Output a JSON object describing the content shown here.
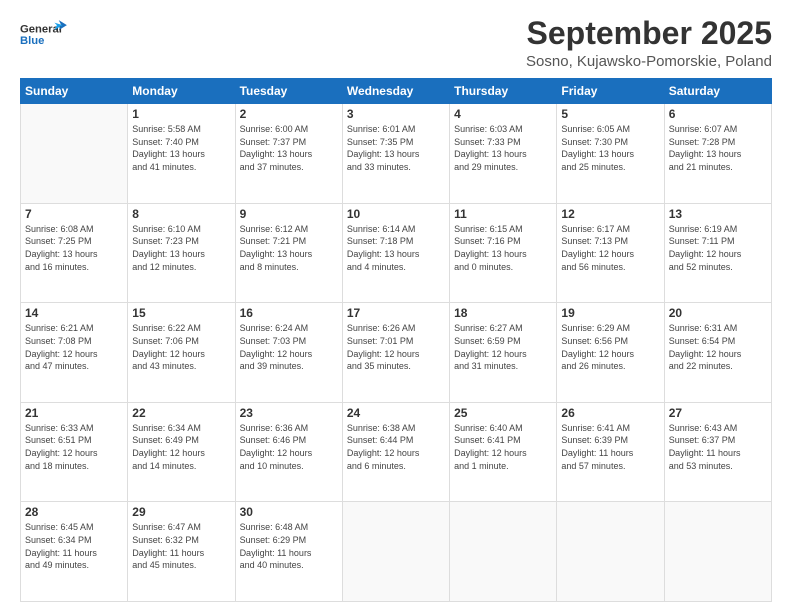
{
  "header": {
    "logo_general": "General",
    "logo_blue": "Blue",
    "title": "September 2025",
    "location": "Sosno, Kujawsko-Pomorskie, Poland"
  },
  "weekdays": [
    "Sunday",
    "Monday",
    "Tuesday",
    "Wednesday",
    "Thursday",
    "Friday",
    "Saturday"
  ],
  "weeks": [
    [
      {
        "day": "",
        "info": ""
      },
      {
        "day": "1",
        "info": "Sunrise: 5:58 AM\nSunset: 7:40 PM\nDaylight: 13 hours\nand 41 minutes."
      },
      {
        "day": "2",
        "info": "Sunrise: 6:00 AM\nSunset: 7:37 PM\nDaylight: 13 hours\nand 37 minutes."
      },
      {
        "day": "3",
        "info": "Sunrise: 6:01 AM\nSunset: 7:35 PM\nDaylight: 13 hours\nand 33 minutes."
      },
      {
        "day": "4",
        "info": "Sunrise: 6:03 AM\nSunset: 7:33 PM\nDaylight: 13 hours\nand 29 minutes."
      },
      {
        "day": "5",
        "info": "Sunrise: 6:05 AM\nSunset: 7:30 PM\nDaylight: 13 hours\nand 25 minutes."
      },
      {
        "day": "6",
        "info": "Sunrise: 6:07 AM\nSunset: 7:28 PM\nDaylight: 13 hours\nand 21 minutes."
      }
    ],
    [
      {
        "day": "7",
        "info": "Sunrise: 6:08 AM\nSunset: 7:25 PM\nDaylight: 13 hours\nand 16 minutes."
      },
      {
        "day": "8",
        "info": "Sunrise: 6:10 AM\nSunset: 7:23 PM\nDaylight: 13 hours\nand 12 minutes."
      },
      {
        "day": "9",
        "info": "Sunrise: 6:12 AM\nSunset: 7:21 PM\nDaylight: 13 hours\nand 8 minutes."
      },
      {
        "day": "10",
        "info": "Sunrise: 6:14 AM\nSunset: 7:18 PM\nDaylight: 13 hours\nand 4 minutes."
      },
      {
        "day": "11",
        "info": "Sunrise: 6:15 AM\nSunset: 7:16 PM\nDaylight: 13 hours\nand 0 minutes."
      },
      {
        "day": "12",
        "info": "Sunrise: 6:17 AM\nSunset: 7:13 PM\nDaylight: 12 hours\nand 56 minutes."
      },
      {
        "day": "13",
        "info": "Sunrise: 6:19 AM\nSunset: 7:11 PM\nDaylight: 12 hours\nand 52 minutes."
      }
    ],
    [
      {
        "day": "14",
        "info": "Sunrise: 6:21 AM\nSunset: 7:08 PM\nDaylight: 12 hours\nand 47 minutes."
      },
      {
        "day": "15",
        "info": "Sunrise: 6:22 AM\nSunset: 7:06 PM\nDaylight: 12 hours\nand 43 minutes."
      },
      {
        "day": "16",
        "info": "Sunrise: 6:24 AM\nSunset: 7:03 PM\nDaylight: 12 hours\nand 39 minutes."
      },
      {
        "day": "17",
        "info": "Sunrise: 6:26 AM\nSunset: 7:01 PM\nDaylight: 12 hours\nand 35 minutes."
      },
      {
        "day": "18",
        "info": "Sunrise: 6:27 AM\nSunset: 6:59 PM\nDaylight: 12 hours\nand 31 minutes."
      },
      {
        "day": "19",
        "info": "Sunrise: 6:29 AM\nSunset: 6:56 PM\nDaylight: 12 hours\nand 26 minutes."
      },
      {
        "day": "20",
        "info": "Sunrise: 6:31 AM\nSunset: 6:54 PM\nDaylight: 12 hours\nand 22 minutes."
      }
    ],
    [
      {
        "day": "21",
        "info": "Sunrise: 6:33 AM\nSunset: 6:51 PM\nDaylight: 12 hours\nand 18 minutes."
      },
      {
        "day": "22",
        "info": "Sunrise: 6:34 AM\nSunset: 6:49 PM\nDaylight: 12 hours\nand 14 minutes."
      },
      {
        "day": "23",
        "info": "Sunrise: 6:36 AM\nSunset: 6:46 PM\nDaylight: 12 hours\nand 10 minutes."
      },
      {
        "day": "24",
        "info": "Sunrise: 6:38 AM\nSunset: 6:44 PM\nDaylight: 12 hours\nand 6 minutes."
      },
      {
        "day": "25",
        "info": "Sunrise: 6:40 AM\nSunset: 6:41 PM\nDaylight: 12 hours\nand 1 minute."
      },
      {
        "day": "26",
        "info": "Sunrise: 6:41 AM\nSunset: 6:39 PM\nDaylight: 11 hours\nand 57 minutes."
      },
      {
        "day": "27",
        "info": "Sunrise: 6:43 AM\nSunset: 6:37 PM\nDaylight: 11 hours\nand 53 minutes."
      }
    ],
    [
      {
        "day": "28",
        "info": "Sunrise: 6:45 AM\nSunset: 6:34 PM\nDaylight: 11 hours\nand 49 minutes."
      },
      {
        "day": "29",
        "info": "Sunrise: 6:47 AM\nSunset: 6:32 PM\nDaylight: 11 hours\nand 45 minutes."
      },
      {
        "day": "30",
        "info": "Sunrise: 6:48 AM\nSunset: 6:29 PM\nDaylight: 11 hours\nand 40 minutes."
      },
      {
        "day": "",
        "info": ""
      },
      {
        "day": "",
        "info": ""
      },
      {
        "day": "",
        "info": ""
      },
      {
        "day": "",
        "info": ""
      }
    ]
  ]
}
